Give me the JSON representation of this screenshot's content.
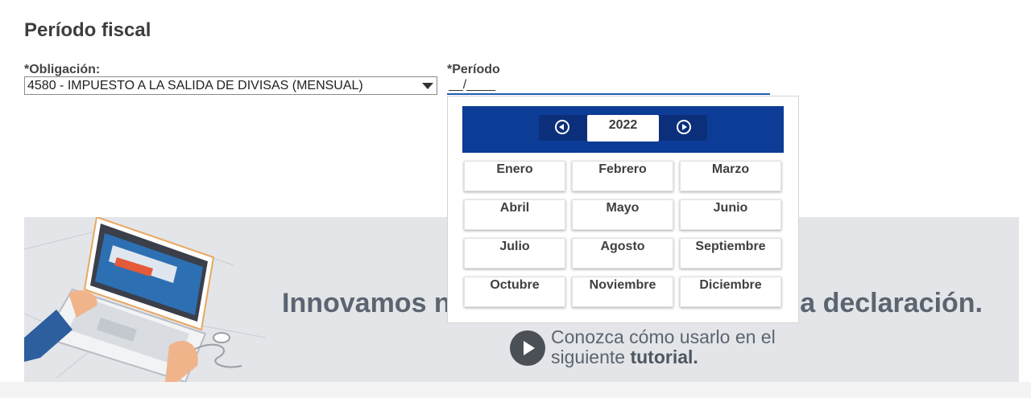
{
  "page": {
    "title": "Período fiscal"
  },
  "obligation": {
    "label": "*Obligación:",
    "selected": "4580 - IMPUESTO A LA SALIDA DE DIVISAS (MENSUAL)"
  },
  "period": {
    "label": "*Período",
    "placeholder": "__/____"
  },
  "calendar": {
    "year": "2022",
    "months": [
      "Enero",
      "Febrero",
      "Marzo",
      "Abril",
      "Mayo",
      "Junio",
      "Julio",
      "Agosto",
      "Septiembre",
      "Octubre",
      "Noviembre",
      "Diciembre"
    ],
    "header_color": "#0d3c96"
  },
  "banner": {
    "headline_visible_start": "Innovamos nues",
    "headline_visible_end": "pida declaración.",
    "sub_line1": "Conozca cómo usarlo en el",
    "sub_line2_prefix": "siguiente ",
    "sub_line2_bold": "tutorial."
  }
}
